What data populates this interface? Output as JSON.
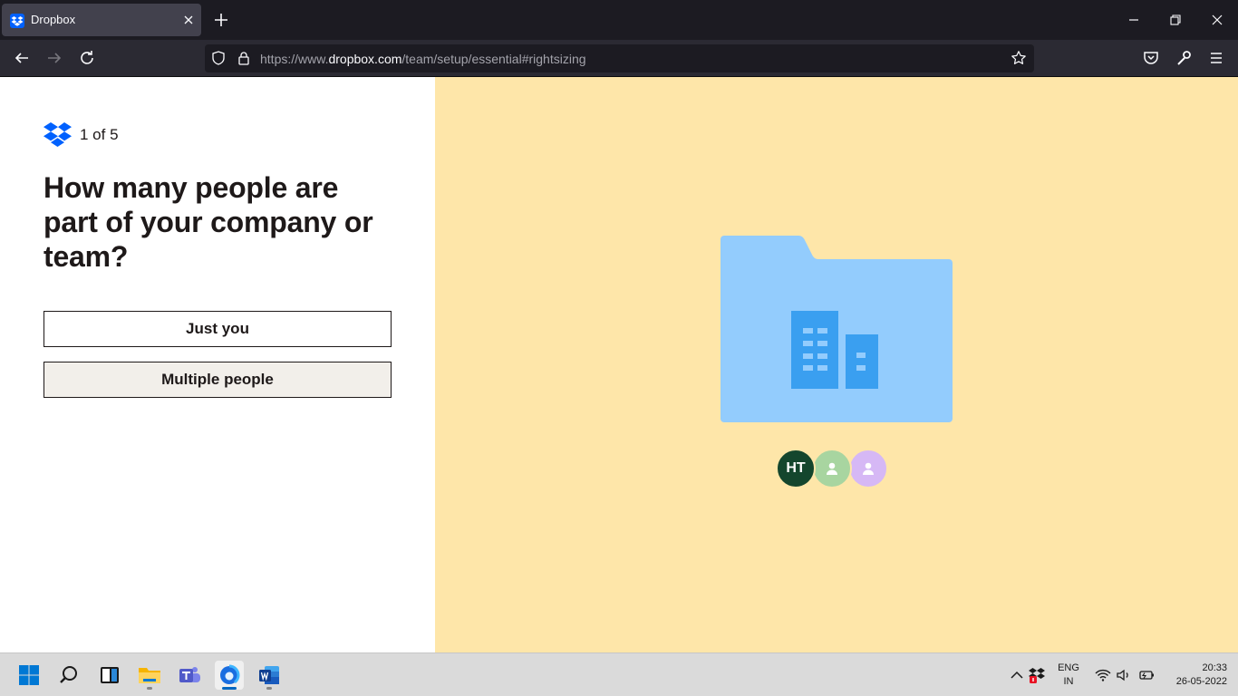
{
  "browser": {
    "tab": {
      "title": "Dropbox"
    },
    "url": {
      "prefix": "https://www.",
      "domain": "dropbox.com",
      "path": "/team/setup/essential#rightsizing"
    }
  },
  "page": {
    "step": "1 of 5",
    "question": "How many people are part of your company or team?",
    "options": [
      {
        "label": "Just you"
      },
      {
        "label": "Multiple people"
      }
    ],
    "avatars": [
      {
        "initials": "HT"
      }
    ]
  },
  "taskbar": {
    "language": {
      "line1": "ENG",
      "line2": "IN"
    },
    "clock": {
      "time": "20:33",
      "date": "26-05-2022"
    }
  },
  "colors": {
    "accent": "#0061fe",
    "illustration_bg": "#fee6a9",
    "folder": "#93ccfd",
    "building": "#3a9ff0"
  }
}
